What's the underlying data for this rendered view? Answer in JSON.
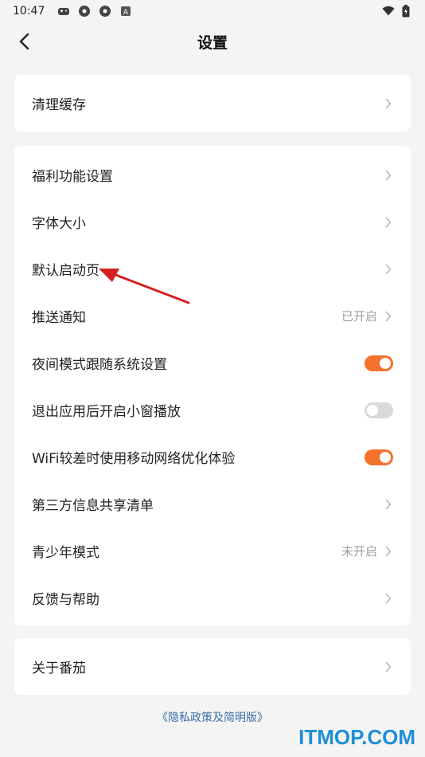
{
  "status_bar": {
    "time": "10:47",
    "icons": [
      "gamepad-icon",
      "app-icon",
      "app-icon",
      "a-icon"
    ],
    "right_icons": [
      "wifi-icon",
      "battery-icon"
    ]
  },
  "header": {
    "title": "设置",
    "back_icon": "back-chevron-icon"
  },
  "cards": {
    "cache": {
      "label": "清理缓存"
    },
    "main": {
      "welfare": "福利功能设置",
      "font_size": "字体大小",
      "default_page": "默认启动页",
      "push": {
        "label": "推送通知",
        "value": "已开启"
      },
      "night": {
        "label": "夜间模式跟随系统设置",
        "state": "on"
      },
      "pip": {
        "label": "退出应用后开启小窗播放",
        "state": "off"
      },
      "wifi": {
        "label": "WiFi较差时使用移动网络优化体验",
        "state": "on"
      },
      "third_party": "第三方信息共享清单",
      "teen": {
        "label": "青少年模式",
        "value": "未开启"
      },
      "feedback": "反馈与帮助"
    },
    "about": {
      "label": "关于番茄"
    }
  },
  "privacy_link": "《隐私政策及简明版》",
  "watermark": "ITMOP.COM",
  "colors": {
    "accent": "#f5722d",
    "link": "#3b6ea8",
    "watermark": "#1e8fd6",
    "annotation": "#d42020"
  }
}
